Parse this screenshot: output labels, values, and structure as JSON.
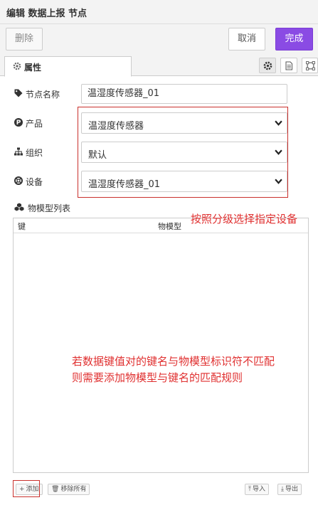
{
  "header": {
    "title": "编辑 数据上报 节点"
  },
  "toolbar": {
    "delete_label": "删除",
    "cancel_label": "取消",
    "done_label": "完成"
  },
  "tabs": {
    "properties_label": "属性"
  },
  "form": {
    "node_name_label": "节点名称",
    "node_name_value": "温湿度传感器_01",
    "product_label": "产品",
    "product_value": "温湿度传感器",
    "org_label": "组织",
    "org_value": "默认",
    "device_label": "设备",
    "device_value": "温湿度传感器_01",
    "model_list_label": "物模型列表"
  },
  "table": {
    "col_key": "键",
    "col_model": "物模型"
  },
  "annotations": {
    "cascade_hint": "按照分级选择指定设备",
    "mapping_hint_line1": "若数据键值对的键名与物模型标识符不匹配",
    "mapping_hint_line2": "则需要添加物模型与键名的匹配规则"
  },
  "footer": {
    "add_label": "添加",
    "remove_all_label": "移除所有",
    "import_label": "导入",
    "export_label": "导出"
  },
  "colors": {
    "accent": "#8a4be4",
    "annotation": "#e03030"
  }
}
